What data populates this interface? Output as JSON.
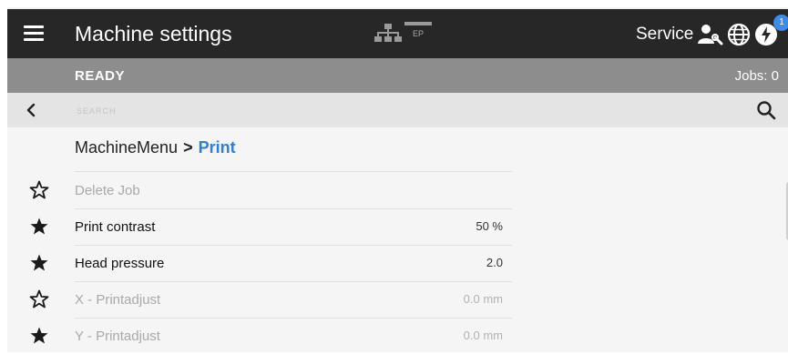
{
  "titlebar": {
    "title": "Machine settings",
    "ep_badge": "EP",
    "service_label": "Service",
    "notification_count": "1",
    "icons": [
      "menu-icon",
      "network-icon",
      "ep-icon",
      "user-wrench-icon",
      "globe-icon",
      "power-icon"
    ]
  },
  "status": {
    "state": "READY",
    "jobs": "Jobs: 0"
  },
  "search": {
    "placeholder": "SEARCH"
  },
  "breadcrumb": {
    "root": "MachineMenu",
    "separator": ">",
    "current": "Print"
  },
  "settings": [
    {
      "label": "Delete Job",
      "value": "",
      "favorite": false,
      "enabled": false
    },
    {
      "label": "Print contrast",
      "value": "50 %",
      "favorite": true,
      "enabled": true
    },
    {
      "label": "Head pressure",
      "value": "2.0",
      "favorite": true,
      "enabled": true
    },
    {
      "label": "X - Printadjust",
      "value": "0.0 mm",
      "favorite": false,
      "enabled": false
    },
    {
      "label": "Y - Printadjust",
      "value": "0.0 mm",
      "favorite": true,
      "enabled": false
    }
  ],
  "colors": {
    "titlebar_bg": "#272727",
    "statusbar_bg": "#8d8d8d",
    "searchbar_bg": "#e4e4e4",
    "accent": "#2d7fd8",
    "badge": "#3d8be8"
  }
}
